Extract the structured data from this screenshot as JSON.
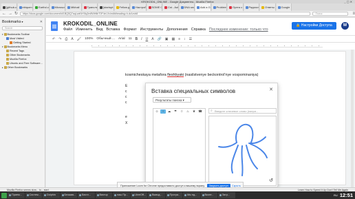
{
  "firefox": {
    "window_title": "KROKODIL_ONLINE - Google Документы - Mozilla Firefox",
    "tabs": [
      "[github.c",
      "ebiquen",
      "Earthd.c",
      "Microsof",
      "Mikhail",
      "Трансля",
      "[startupt",
      "Fellow.gif",
      "Настройт",
      "SOME C",
      "Cst - Aut",
      "DNA sec",
      "Add a G",
      "Problem",
      "Opera c",
      "Радиост",
      "Ответы",
      "Google"
    ],
    "url": "https://docs.google.com/document/d/1BQ5Q7aqLzaKbY8q2m8WbNhT0F4eI-Xv/edit#heading=h.dv1zvb8",
    "search_placeholder": "Поиск",
    "status_left": "Mozilla Firefox seems slow... to... start.",
    "status_right": "Learn How to Speed It Up    Don't Tell Me Again"
  },
  "sidebar": {
    "title": "Bookmarks",
    "search_placeholder": "Search",
    "items": [
      {
        "label": "Bookmarks Toolbar",
        "indent": 0,
        "icon": "fold"
      },
      {
        "label": "Most Visited",
        "indent": 1,
        "icon": "blue"
      },
      {
        "label": "Getting Started",
        "indent": 2,
        "icon": "orange"
      },
      {
        "label": "Bookmarks Menu",
        "indent": 0,
        "icon": "fold"
      },
      {
        "label": "Recent Tags",
        "indent": 1,
        "icon": "fold"
      },
      {
        "label": "Other Bookmarks",
        "indent": 1,
        "icon": "fold"
      },
      {
        "label": "Mozilla Firefox",
        "indent": 1,
        "icon": "fold"
      },
      {
        "label": "Ubuntu and Free Software...",
        "indent": 1,
        "icon": "fold"
      },
      {
        "label": "Other Bookmarks",
        "indent": 0,
        "icon": "fold"
      }
    ]
  },
  "docs": {
    "title": "KROKODIL_ONLINE",
    "menu": [
      "Файл",
      "Изменить",
      "Вид",
      "Вставка",
      "Формат",
      "Инструменты",
      "Дополнения",
      "Справка"
    ],
    "last_edit": "Последнее изменение: только что",
    "share_label": "Настройки Доступа",
    "avatar_letter": "M",
    "toolbar": {
      "zoom": "100%",
      "style": "Обычный ...",
      "font": "Arial",
      "size": "11"
    },
    "paragraph_before": "kosmicheskaya metafora ",
    "paragraph_link": "fleshbyaki",
    "paragraph_after": " (nasilstvenye beckontrol'nye vospominaniya)",
    "lead_letters": [
      "E",
      "c",
      "c",
      "c",
      "e",
      "X"
    ]
  },
  "dialog": {
    "title": "Вставка специальных символов",
    "select_label": "Результаты поиска",
    "draw_placeholder": "Введите ключевое слово (напри...",
    "grid_glyphs": [
      "☺",
      "♀",
      "☁",
      "☂",
      "☃",
      "♨",
      "♛",
      "☎"
    ]
  },
  "notification": {
    "text": "Приложение Loom for Chrome предоставило доступ к вашему экрану.",
    "primary": "Закрыть доступ",
    "secondary": "Скрыть"
  },
  "taskbar": {
    "items": [
      "Прием...",
      "Систем...",
      "Dolphin",
      "Безымя...",
      "Бюлл...",
      "Виктор",
      "наш Пр...",
      "LibreOff...",
      "Вывод...",
      "Програ...",
      "Мы ед...",
      "Вконт...",
      "Загр..."
    ],
    "lang": "RU",
    "clock": "12:51"
  }
}
